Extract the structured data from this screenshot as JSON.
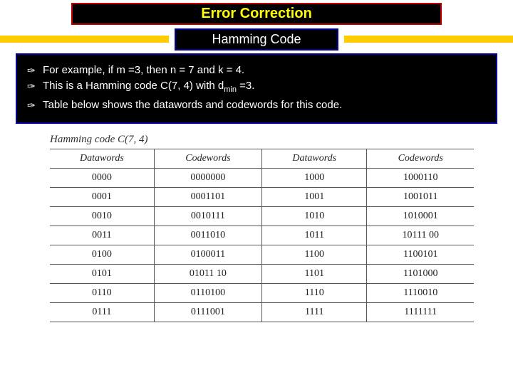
{
  "title": "Error Correction",
  "subtitle": "Hamming Code",
  "bullets": {
    "b1_pre": "For example, if m =3, then n = 7 and k = 4.",
    "b2_pre": "This is a Hamming code C(7, 4) with d",
    "b2_sub": "min",
    "b2_post": " =3.",
    "b3_pre": "Table below shows the datawords and codewords for this code."
  },
  "table_caption": "Hamming code C(7, 4)",
  "headers": {
    "h1": "Datawords",
    "h2": "Codewords",
    "h3": "Datawords",
    "h4": "Codewords"
  },
  "chart_data": {
    "type": "table",
    "columns": [
      "Datawords",
      "Codewords",
      "Datawords",
      "Codewords"
    ],
    "rows": [
      [
        "0000",
        "0000000",
        "1000",
        "1000110"
      ],
      [
        "0001",
        "0001101",
        "1001",
        "1001011"
      ],
      [
        "0010",
        "0010111",
        "1010",
        "1010001"
      ],
      [
        "0011",
        "0011010",
        "1011",
        "10111 00"
      ],
      [
        "0100",
        "0100011",
        "1100",
        "1100101"
      ],
      [
        "0101",
        "01011 10",
        "1101",
        "1101000"
      ],
      [
        "0110",
        "0110100",
        "1110",
        "1110010"
      ],
      [
        "0111",
        "0111001",
        "1111",
        "1111111"
      ]
    ]
  }
}
